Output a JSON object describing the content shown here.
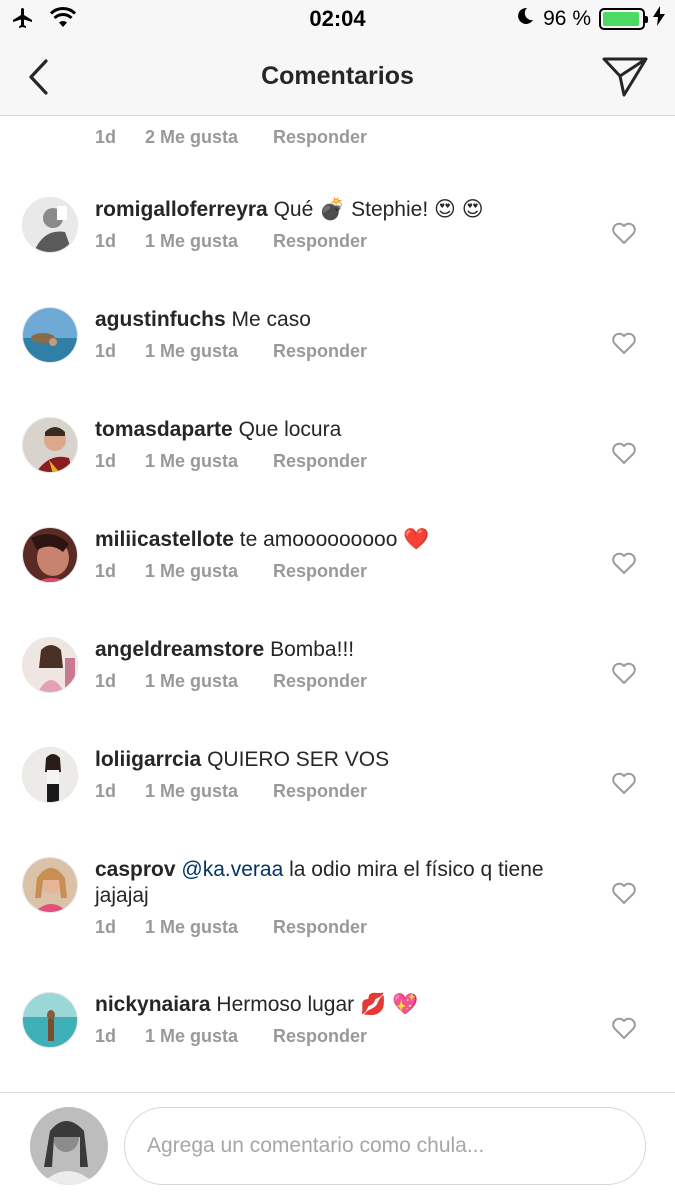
{
  "status_bar": {
    "time": "02:04",
    "battery_percent": "96 %",
    "battery_level": 0.96
  },
  "header": {
    "title": "Comentarios"
  },
  "previous_meta": {
    "time": "1d",
    "likes": "2 Me gusta",
    "reply": "Responder"
  },
  "comments": [
    {
      "user": "romigalloferreyra",
      "text": "Qué 💣 Stephie! 😍 😍",
      "time": "1d",
      "likes": "1 Me gusta",
      "reply": "Responder"
    },
    {
      "user": "agustinfuchs",
      "text": "Me caso",
      "time": "1d",
      "likes": "1 Me gusta",
      "reply": "Responder"
    },
    {
      "user": "tomasdaparte",
      "text": "Que locura",
      "time": "1d",
      "likes": "1 Me gusta",
      "reply": "Responder"
    },
    {
      "user": "miliicastellote",
      "text": "te amooooooooo ❤️",
      "time": "1d",
      "likes": "1 Me gusta",
      "reply": "Responder"
    },
    {
      "user": "angeldreamstore",
      "text": "Bomba!!!",
      "time": "1d",
      "likes": "1 Me gusta",
      "reply": "Responder"
    },
    {
      "user": "loliigarrcia",
      "text": "QUIERO SER VOS",
      "time": "1d",
      "likes": "1 Me gusta",
      "reply": "Responder"
    },
    {
      "user": "casprov",
      "mention": "@ka.veraa",
      "text": "la odio mira el físico q tiene jajajaj",
      "time": "1d",
      "likes": "1 Me gusta",
      "reply": "Responder"
    },
    {
      "user": "nickynaiara",
      "text": "Hermoso lugar 💋 💖",
      "time": "1d",
      "likes": "1 Me gusta",
      "reply": "Responder"
    }
  ],
  "composer": {
    "placeholder": "Agrega un comentario como chula..."
  }
}
